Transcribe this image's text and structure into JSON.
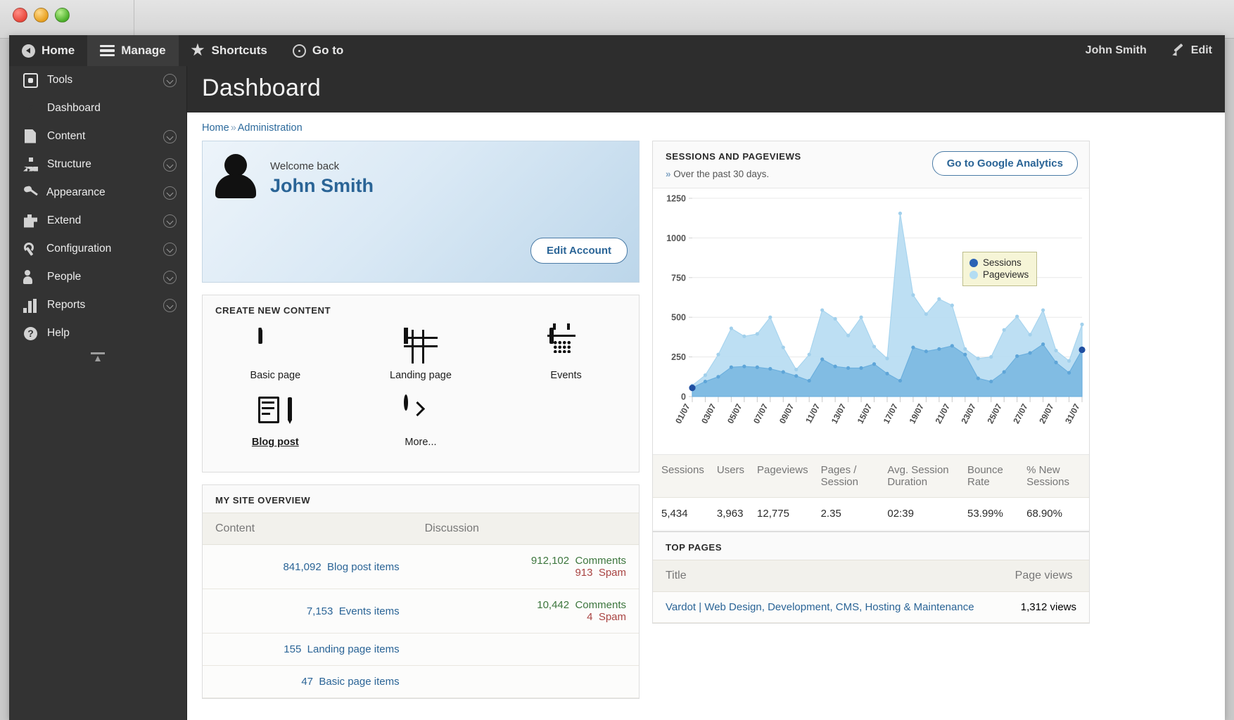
{
  "window": {
    "traffic_lights": [
      "close",
      "minimize",
      "zoom"
    ]
  },
  "toolbar": {
    "items": [
      {
        "label": "Home",
        "icon": "home-icon",
        "active": false
      },
      {
        "label": "Manage",
        "icon": "hamburger-icon",
        "active": true
      },
      {
        "label": "Shortcuts",
        "icon": "star-icon",
        "active": false
      },
      {
        "label": "Go to",
        "icon": "search-target-icon",
        "active": false
      }
    ],
    "user_name": "John Smith",
    "edit_label": "Edit"
  },
  "sidebar": {
    "items": [
      {
        "label": "Tools",
        "icon": "tools-icon",
        "has_chevron": true
      },
      {
        "label": "Dashboard",
        "icon": "dashboard-gauge-icon",
        "has_chevron": false
      },
      {
        "label": "Content",
        "icon": "document-icon",
        "has_chevron": true
      },
      {
        "label": "Structure",
        "icon": "sitemap-icon",
        "has_chevron": true
      },
      {
        "label": "Appearance",
        "icon": "paintbrush-icon",
        "has_chevron": true
      },
      {
        "label": "Extend",
        "icon": "puzzle-icon",
        "has_chevron": true
      },
      {
        "label": "Configuration",
        "icon": "wrench-icon",
        "has_chevron": true
      },
      {
        "label": "People",
        "icon": "people-icon",
        "has_chevron": true
      },
      {
        "label": "Reports",
        "icon": "bar-chart-icon",
        "has_chevron": true
      },
      {
        "label": "Help",
        "icon": "question-mark-icon",
        "has_chevron": false
      }
    ]
  },
  "page": {
    "title": "Dashboard",
    "breadcrumb": {
      "home": "Home",
      "separator": "»",
      "current": "Administration"
    }
  },
  "welcome": {
    "greeting": "Welcome back",
    "name": "John Smith",
    "edit_account_label": "Edit Account"
  },
  "create_content": {
    "title": "CREATE NEW CONTENT",
    "items": [
      {
        "label": "Basic page",
        "icon": "page-icon",
        "emphasis": false
      },
      {
        "label": "Landing page",
        "icon": "table-grid-icon",
        "emphasis": false
      },
      {
        "label": "Events",
        "icon": "calendar-icon",
        "emphasis": false
      },
      {
        "label": "Blog post",
        "icon": "blog-pen-icon",
        "emphasis": true
      },
      {
        "label": "More...",
        "icon": "chevron-right-circle-icon",
        "emphasis": false
      }
    ]
  },
  "site_overview": {
    "title": "MY SITE OVERVIEW",
    "headers": [
      "Content",
      "Discussion"
    ],
    "rows": [
      {
        "count": "841,092",
        "label": "Blog post items",
        "discussion": [
          {
            "count": "912,102",
            "label": "Comments",
            "kind": "comments"
          },
          {
            "count": "913",
            "label": "Spam",
            "kind": "spam"
          }
        ]
      },
      {
        "count": "7,153",
        "label": "Events items",
        "discussion": [
          {
            "count": "10,442",
            "label": "Comments",
            "kind": "comments"
          },
          {
            "count": "4",
            "label": "Spam",
            "kind": "spam"
          }
        ]
      },
      {
        "count": "155",
        "label": "Landing page items",
        "discussion": []
      },
      {
        "count": "47",
        "label": "Basic page items",
        "discussion": []
      }
    ]
  },
  "analytics": {
    "title": "SESSIONS AND PAGEVIEWS",
    "subtitle_arrow": "»",
    "subtitle": "Over the past 30 days.",
    "button_label": "Go to Google Analytics",
    "legend": [
      {
        "label": "Sessions",
        "color": "#2b63b5"
      },
      {
        "label": "Pageviews",
        "color": "#b3ddf2"
      }
    ],
    "stats_headers": [
      "Sessions",
      "Users",
      "Pageviews",
      "Pages / Session",
      "Avg. Session Duration",
      "Bounce Rate",
      "% New Sessions"
    ],
    "stats_values": [
      "5,434",
      "3,963",
      "12,775",
      "2.35",
      "02:39",
      "53.99%",
      "68.90%"
    ]
  },
  "top_pages": {
    "title": "TOP PAGES",
    "headers": [
      "Title",
      "Page views"
    ],
    "rows": [
      {
        "title": "Vardot | Web Design, Development, CMS, Hosting & Maintenance",
        "views": "1,312 views"
      }
    ]
  },
  "chart_data": {
    "type": "area",
    "title": "Sessions and Pageviews",
    "xlabel": "",
    "ylabel": "",
    "ylim": [
      0,
      1250
    ],
    "yticks": [
      0,
      250,
      500,
      750,
      1000,
      1250
    ],
    "grid": true,
    "legend_position": "inside-right",
    "x": [
      "01/07",
      "02/07",
      "03/07",
      "04/07",
      "05/07",
      "06/07",
      "07/07",
      "08/07",
      "09/07",
      "10/07",
      "11/07",
      "12/07",
      "13/07",
      "14/07",
      "15/07",
      "16/07",
      "17/07",
      "18/07",
      "19/07",
      "20/07",
      "21/07",
      "22/07",
      "23/07",
      "24/07",
      "25/07",
      "26/07",
      "27/07",
      "28/07",
      "29/07",
      "30/07",
      "31/07"
    ],
    "xticks": [
      "01/07",
      "03/07",
      "05/07",
      "07/07",
      "09/07",
      "11/07",
      "13/07",
      "15/07",
      "17/07",
      "19/07",
      "21/07",
      "23/07",
      "25/07",
      "27/07",
      "29/07",
      "31/07"
    ],
    "series": [
      {
        "name": "Pageviews",
        "color": "#b9ddf2",
        "values": [
          70,
          135,
          265,
          430,
          380,
          395,
          500,
          310,
          170,
          265,
          545,
          490,
          385,
          500,
          315,
          240,
          1155,
          640,
          520,
          615,
          575,
          300,
          240,
          250,
          420,
          505,
          390,
          545,
          290,
          225,
          455
        ]
      },
      {
        "name": "Sessions",
        "color": "#7cb8e2",
        "values": [
          55,
          95,
          125,
          185,
          190,
          185,
          175,
          155,
          130,
          100,
          235,
          190,
          180,
          180,
          205,
          145,
          100,
          310,
          285,
          300,
          320,
          265,
          115,
          95,
          155,
          255,
          275,
          330,
          215,
          150,
          295
        ]
      }
    ]
  }
}
